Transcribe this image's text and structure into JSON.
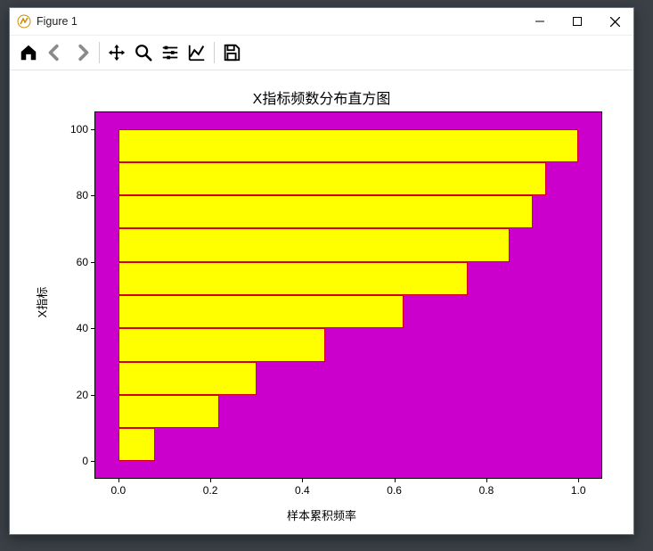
{
  "window": {
    "title": "Figure 1"
  },
  "toolbar": {
    "home": "home",
    "back": "back",
    "forward": "forward",
    "pan": "pan",
    "zoom": "zoom",
    "config": "configure",
    "edit": "edit-axis",
    "save": "save"
  },
  "chart_data": {
    "type": "bar",
    "orientation": "horizontal",
    "title": "X指标频数分布直方图",
    "xlabel": "样本累积频率",
    "ylabel": "X指标",
    "bar_width_y": 10,
    "y_bins_start": [
      0,
      10,
      20,
      30,
      40,
      50,
      60,
      70,
      80,
      90
    ],
    "values": [
      0.08,
      0.22,
      0.3,
      0.45,
      0.62,
      0.76,
      0.85,
      0.9,
      0.93,
      1.0
    ],
    "xlim": [
      -0.05,
      1.05
    ],
    "ylim": [
      -5,
      105
    ],
    "xticks": [
      0.0,
      0.2,
      0.4,
      0.6,
      0.8,
      1.0
    ],
    "xtick_labels": [
      "0.0",
      "0.2",
      "0.4",
      "0.6",
      "0.8",
      "1.0"
    ],
    "yticks": [
      0,
      20,
      40,
      60,
      80,
      100
    ],
    "ytick_labels": [
      "0",
      "20",
      "40",
      "60",
      "80",
      "100"
    ],
    "bar_color": "#ffff00",
    "bar_edge": "#d40000",
    "bg_color": "#cc00cc"
  }
}
